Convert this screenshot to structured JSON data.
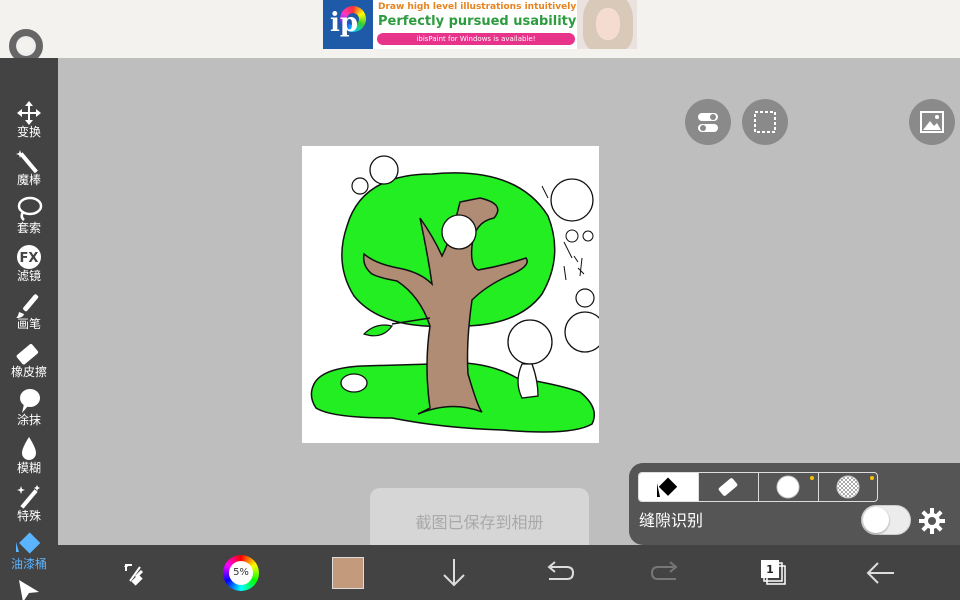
{
  "ad": {
    "line1": "Draw high level illustrations intuitively!",
    "line2": "Perfectly pursued usability!",
    "line3": "ibisPaint for Windows is available!",
    "logo_text": "ip"
  },
  "tools": [
    {
      "label": "变换",
      "icon": "move-icon"
    },
    {
      "label": "魔棒",
      "icon": "magic-wand-icon"
    },
    {
      "label": "套索",
      "icon": "lasso-icon"
    },
    {
      "label": "滤镜",
      "icon": "fx-filter-icon",
      "glyph": "FX"
    },
    {
      "label": "画笔",
      "icon": "brush-icon"
    },
    {
      "label": "橡皮擦",
      "icon": "eraser-icon"
    },
    {
      "label": "涂抹",
      "icon": "smudge-icon"
    },
    {
      "label": "模糊",
      "icon": "blur-drop-icon"
    },
    {
      "label": "特殊",
      "icon": "special-sparkle-icon"
    },
    {
      "label": "油漆桶",
      "icon": "paint-bucket-icon",
      "active": true
    }
  ],
  "bucket_panel": {
    "gap_label": "缝隙识别",
    "gap_enabled": false
  },
  "toast": "截图已保存到相册",
  "bottom": {
    "brush_size": "5%",
    "current_color": "#c49a7c",
    "layer_count": "1"
  },
  "colors": {
    "toolbar": "#434343",
    "canvas_bg": "#bebebe",
    "accent": "#5ab4ff",
    "fill_green": "#22ee22",
    "trunk": "#b08c74"
  }
}
